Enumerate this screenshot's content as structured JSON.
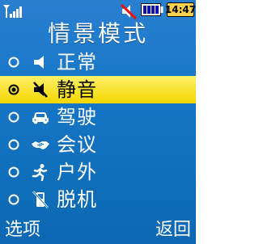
{
  "status": {
    "time": "14:47",
    "signal_icon": "signal-bars-icon",
    "mute_icon": "muted-speaker-icon",
    "battery_icon": "battery-icon"
  },
  "title": "情景模式",
  "profiles": [
    {
      "label": "正常",
      "icon": "speaker-icon",
      "selected": false
    },
    {
      "label": "静音",
      "icon": "speaker-muted-icon",
      "selected": true
    },
    {
      "label": "驾驶",
      "icon": "car-icon",
      "selected": false
    },
    {
      "label": "会议",
      "icon": "handshake-icon",
      "selected": false
    },
    {
      "label": "户外",
      "icon": "runner-icon",
      "selected": false
    },
    {
      "label": "脱机",
      "icon": "phone-off-icon",
      "selected": false
    }
  ],
  "softkeys": {
    "left": "选项",
    "right": "返回"
  },
  "colors": {
    "background_top": "#2a7fd1",
    "background_bottom": "#0d67b3",
    "highlight": "#f4d700",
    "clock_bg": "#f8d04d"
  }
}
